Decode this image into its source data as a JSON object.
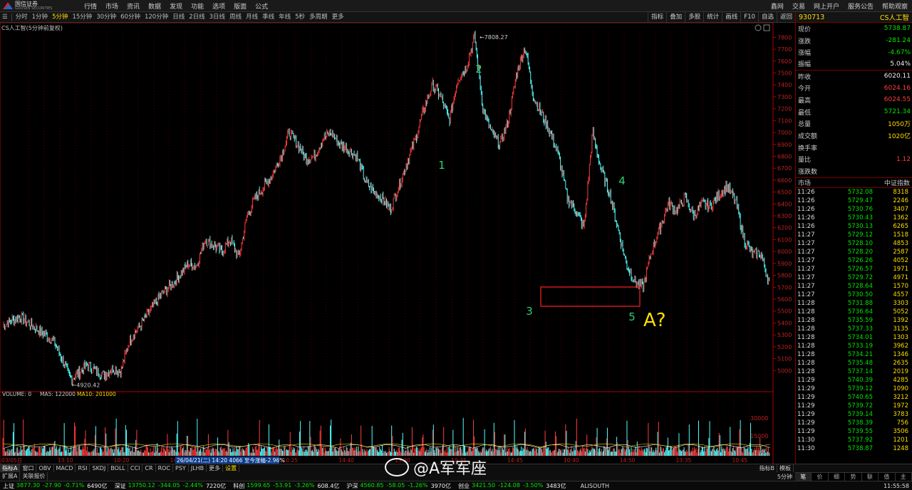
{
  "menubar": {
    "brand": "国信证券",
    "brand_sub": "GUOSEN SECURITIES",
    "items": [
      "行情",
      "市场",
      "资讯",
      "数据",
      "发现",
      "功能",
      "选项",
      "版面",
      "公式"
    ],
    "right_items": [
      "鑫网",
      "交易",
      "网上开户",
      "服务公告",
      "帮助观察"
    ]
  },
  "toolbar": {
    "periods": [
      "分时",
      "1分钟",
      "5分钟",
      "15分钟",
      "30分钟",
      "60分钟",
      "120分钟",
      "日线",
      "2日线",
      "3日线",
      "周线",
      "月线",
      "季线",
      "年线",
      "5秒",
      "多周期",
      "更多"
    ],
    "active_period": "5分钟",
    "right_buttons": [
      "指标",
      "叠加",
      "多股",
      "统计",
      "画线",
      "F10",
      "自选",
      "返回"
    ]
  },
  "chart": {
    "info_head": "CS人工智(5分钟前复权)",
    "high_label": "7808.27",
    "low_label": "4920.42",
    "volume_head": "VOLUME: 0",
    "ma5_label": "MA5: 122000",
    "ma10_label": "MA10: 201000",
    "price_ticks": [
      "7800",
      "7700",
      "7600",
      "7500",
      "7400",
      "7300",
      "7200",
      "7100",
      "7000",
      "6900",
      "6800",
      "6700",
      "6600",
      "6500",
      "6400",
      "6300",
      "6200",
      "6100",
      "6000",
      "5900",
      "5800",
      "5700",
      "5600",
      "5500",
      "5400",
      "5300",
      "5200",
      "5100",
      "5000"
    ],
    "volume_ticks": [
      "30000",
      "15000",
      "X100"
    ],
    "time_labels": [
      "03/05日",
      "13:10",
      "10:20",
      "14:35",
      "13:15",
      "10:25",
      "14:40",
      "13:20",
      "10:35",
      "14:45",
      "10:40",
      "14:50",
      "13:35",
      "10:45"
    ],
    "tooltip": "26/04/21(二) 14:20 4066 至今涨幅-2.96%",
    "wave_labels": [
      "1",
      "2",
      "3",
      "4",
      "5"
    ],
    "annotation": "A?",
    "colors": {
      "up": "#ff3c3c",
      "down": "#54ffff",
      "grid": "#8b0000",
      "axis": "#b00000",
      "wave": "#2dd36f",
      "annot": "#ffde00"
    }
  },
  "chart_data": {
    "type": "line",
    "title": "CS人工智(5分钟前复权)",
    "ylim": [
      4900,
      7850
    ],
    "y2_ticks": [
      30000,
      15000
    ],
    "series": [
      {
        "values": [
          5380,
          5420,
          5450,
          5400,
          5350,
          5300,
          5250,
          5100,
          4930,
          4980,
          5050,
          5000,
          4960,
          5020,
          4990,
          5250,
          5350,
          5450,
          5560,
          5650,
          5720,
          5800,
          5900,
          5880,
          6100,
          6050,
          6000,
          6100,
          5950,
          6300,
          6450,
          6550,
          6650,
          6800,
          7000,
          6900,
          6780,
          6800,
          6950,
          7000,
          6900,
          6860,
          6800,
          6600,
          6500,
          6450,
          6350,
          6550,
          6750,
          6950,
          7200,
          7400,
          7300,
          7100,
          7450,
          7550,
          7808,
          7200,
          7000,
          6900,
          7100,
          7500,
          7720,
          7300,
          7150,
          7000,
          6800,
          6450,
          6350,
          6200,
          7000,
          6700,
          6500,
          6200,
          5900,
          5750,
          5700,
          6000,
          6200,
          6400,
          6350,
          6450,
          6300,
          6400,
          6380,
          6480,
          6550,
          6420,
          6100,
          5980,
          5980,
          5730
        ]
      }
    ]
  },
  "quote": {
    "code": "930713",
    "name": "CS人工智",
    "rows": [
      {
        "k": "现价",
        "v": "5738.87",
        "c": "green"
      },
      {
        "k": "涨跌",
        "v": "-281.24",
        "c": "green"
      },
      {
        "k": "涨幅",
        "v": "-4.67%",
        "c": "green"
      },
      {
        "k": "振幅",
        "v": "5.04%",
        "c": "white"
      },
      {
        "k": "昨收",
        "v": "6020.11",
        "c": "white",
        "sep": true
      },
      {
        "k": "今开",
        "v": "6024.16",
        "c": "red"
      },
      {
        "k": "最高",
        "v": "6024.55",
        "c": "red"
      },
      {
        "k": "最低",
        "v": "5721.34",
        "c": "green"
      },
      {
        "k": "总量",
        "v": "1050万",
        "c": "yellow"
      },
      {
        "k": "成交额",
        "v": "1020亿",
        "c": "yellow"
      },
      {
        "k": "换手率",
        "v": "",
        "c": "white"
      },
      {
        "k": "量比",
        "v": "1.12",
        "c": "red"
      },
      {
        "k": "涨跌数",
        "v": "",
        "c": "white"
      }
    ],
    "tick_head_left": "市场",
    "tick_head_right": "中证指数",
    "ticks": [
      [
        "11:26",
        "5732.08",
        "8318"
      ],
      [
        "11:26",
        "5729.47",
        "2246"
      ],
      [
        "11:26",
        "5730.76",
        "3407"
      ],
      [
        "11:26",
        "5730.43",
        "1362"
      ],
      [
        "11:26",
        "5730.13",
        "6265"
      ],
      [
        "11:27",
        "5729.12",
        "1518"
      ],
      [
        "11:27",
        "5728.10",
        "4853"
      ],
      [
        "11:27",
        "5728.20",
        "2587"
      ],
      [
        "11:27",
        "5726.26",
        "4052"
      ],
      [
        "11:27",
        "5726.57",
        "1971"
      ],
      [
        "11:27",
        "5729.72",
        "4971"
      ],
      [
        "11:27",
        "5728.64",
        "1570"
      ],
      [
        "11:27",
        "5730.50",
        "4557"
      ],
      [
        "11:28",
        "5731.88",
        "3303"
      ],
      [
        "11:28",
        "5736.64",
        "5052"
      ],
      [
        "11:28",
        "5735.59",
        "1392"
      ],
      [
        "11:28",
        "5737.33",
        "3135"
      ],
      [
        "11:28",
        "5734.01",
        "1303"
      ],
      [
        "11:28",
        "5733.19",
        "3962"
      ],
      [
        "11:28",
        "5734.21",
        "1346"
      ],
      [
        "11:28",
        "5735.48",
        "2635"
      ],
      [
        "11:28",
        "5737.14",
        "2019"
      ],
      [
        "11:29",
        "5740.39",
        "4285"
      ],
      [
        "11:29",
        "5739.12",
        "1090"
      ],
      [
        "11:29",
        "5740.65",
        "3212"
      ],
      [
        "11:29",
        "5739.72",
        "1972"
      ],
      [
        "11:29",
        "5739.14",
        "3783"
      ],
      [
        "11:29",
        "5738.39",
        "756"
      ],
      [
        "11:29",
        "5739.55",
        "3506"
      ],
      [
        "11:30",
        "5737.92",
        "1201"
      ],
      [
        "11:30",
        "5738.87",
        "1248"
      ]
    ],
    "tabs": [
      "笔",
      "价",
      "细",
      "势",
      "联",
      "值",
      "主"
    ],
    "period_tag": "5分钟"
  },
  "indicators": {
    "tabs": [
      "指标A",
      "窗口",
      "OBV",
      "MACD",
      "RSI",
      "SKDJ",
      "BOLL",
      "CCI",
      "CR",
      "ROC",
      "PSY",
      "JLHB",
      "更多",
      "设置"
    ],
    "active": "设置",
    "right": [
      "指标B",
      "模板"
    ],
    "sub_tabs": [
      "扩展A",
      "关联报价"
    ]
  },
  "statusbar": [
    {
      "name": "上证",
      "value": "3877.30",
      "chg": "-27.90",
      "pct": "-0.71%",
      "amt": "6490亿"
    },
    {
      "name": "深证",
      "value": "13750.12",
      "chg": "-344.05",
      "pct": "-2.44%",
      "amt": "7220亿"
    },
    {
      "name": "科创",
      "value": "1599.65",
      "chg": "-53.91",
      "pct": "-3.26%",
      "amt": "608.4亿"
    },
    {
      "name": "沪深",
      "value": "4560.85",
      "chg": "-58.05",
      "pct": "-1.26%",
      "amt": "3970亿"
    },
    {
      "name": "创业",
      "value": "3421.50",
      "chg": "-124.08",
      "pct": "-3.50%",
      "amt": "3483亿"
    }
  ],
  "status_right": {
    "server": "ALISOUTH",
    "time": "11:55:58"
  },
  "watermark": "@A军军座"
}
